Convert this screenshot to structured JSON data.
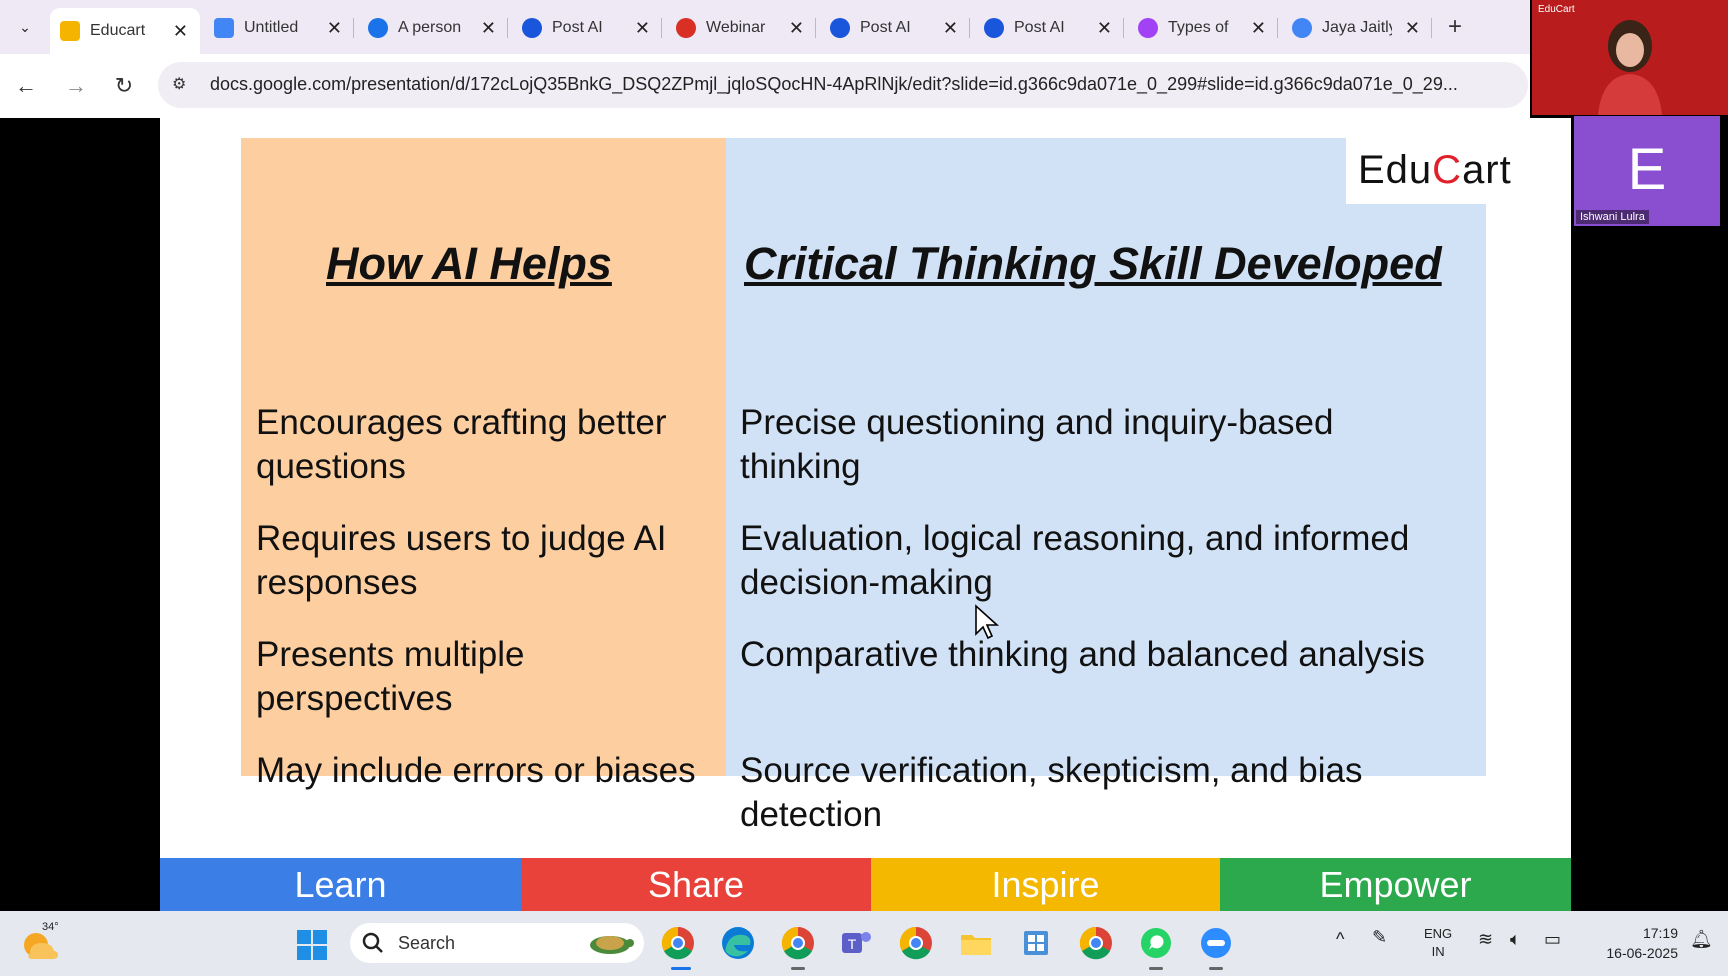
{
  "browser": {
    "tabs": [
      {
        "title": "Educart",
        "icon": "slides-icon",
        "color": "#f4b400",
        "active": true
      },
      {
        "title": "Untitled",
        "icon": "docs-icon",
        "color": "#4285f4",
        "active": false
      },
      {
        "title": "A person",
        "icon": "app-icon",
        "color": "#1a73e8",
        "active": false
      },
      {
        "title": "Post AI",
        "icon": "app-icon",
        "color": "#1a56db",
        "active": false
      },
      {
        "title": "Webinar",
        "icon": "gmail-icon",
        "color": "#d93025",
        "active": false
      },
      {
        "title": "Post AI",
        "icon": "app-icon",
        "color": "#1a56db",
        "active": false
      },
      {
        "title": "Post AI",
        "icon": "app-icon",
        "color": "#1a56db",
        "active": false
      },
      {
        "title": "Types of",
        "icon": "app-icon",
        "color": "#a142f4",
        "active": false
      },
      {
        "title": "Jaya Jaitly",
        "icon": "google-icon",
        "color": "#4285f4",
        "active": false
      }
    ],
    "close_glyph": "✕",
    "new_tab_glyph": "+",
    "url": "docs.google.com/presentation/d/172cLojQ35BnkG_DSQ2ZPmjl_jqloSQocHN-4ApRlNjk/edit?slide=id.g366c9da071e_0_299#slide=id.g366c9da071e_0_29..."
  },
  "slide": {
    "header_left": "How AI Helps",
    "header_right": "Critical Thinking Skill Developed",
    "rows": [
      {
        "left": "Encourages crafting better questions",
        "right": "Precise questioning and inquiry-based thinking"
      },
      {
        "left": "Requires users to judge AI responses",
        "right": "Evaluation, logical reasoning, and informed decision-making"
      },
      {
        "left": "Presents multiple perspectives",
        "right": "Comparative thinking and balanced analysis"
      },
      {
        "left": "May include errors or biases",
        "right": "Source verification, skepticism, and bias detection"
      }
    ],
    "logo": {
      "part1": "Edu",
      "part2": "C",
      "part3": "art"
    },
    "banner": [
      {
        "label": "Learn",
        "color": "#3b7ee6"
      },
      {
        "label": "Share",
        "color": "#e8423a"
      },
      {
        "label": "Inspire",
        "color": "#f5b800"
      },
      {
        "label": "Empower",
        "color": "#2ca84d"
      }
    ],
    "colors": {
      "left_column": "#fdcfa0",
      "right_column": "#d2e2f6"
    }
  },
  "meeting": {
    "cam1_label": "EduCart",
    "cam2_initial": "E",
    "cam2_name": "Ishwani Lulra"
  },
  "taskbar": {
    "weather_temp": "34°",
    "search_label": "Search",
    "lang_line1": "ENG",
    "lang_line2": "IN",
    "time": "17:19",
    "date": "16-06-2025"
  }
}
